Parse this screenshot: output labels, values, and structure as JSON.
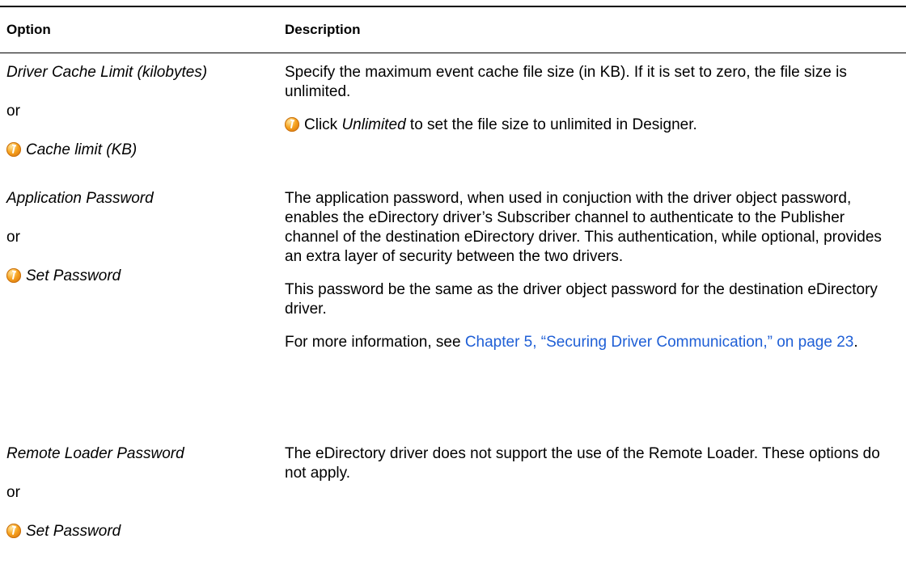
{
  "table": {
    "header": {
      "option": "Option",
      "description": "Description"
    },
    "rows": [
      {
        "option_main": "Driver Cache Limit (kilobytes)",
        "or": "or",
        "option_designer": "Cache limit (KB)",
        "desc": {
          "p1": "Specify the maximum event cache file size (in KB). If it is set to zero, the file size is unlimited.",
          "p2_pre": "Click ",
          "p2_em": "Unlimited",
          "p2_post": " to set the file size to unlimited in Designer."
        }
      },
      {
        "option_main": "Application Password",
        "or": "or",
        "option_designer": "Set Password",
        "desc": {
          "p1": "The application password, when used in conjuction with the driver object password, enables the eDirectory driver’s Subscriber channel to authenticate to the Publisher channel of the destination eDirectory driver. This authentication, while optional, provides an extra layer of security between the two drivers.",
          "p2": "This password be the same as the driver object password for the destination eDirectory driver.",
          "p3_pre": "For more information, see ",
          "p3_link": "Chapter 5, “Securing Driver Communication,” on page 23",
          "p3_post": "."
        }
      },
      {
        "option_main": "Remote Loader Password",
        "or": "or",
        "option_designer": "Set Password",
        "desc": {
          "p1": "The eDirectory driver does not support the use of the Remote Loader. These options do not apply."
        }
      }
    ]
  },
  "icons": {
    "designer": "designer-icon"
  },
  "colors": {
    "link": "#1f5fd6",
    "icon": "#f6a21e"
  }
}
